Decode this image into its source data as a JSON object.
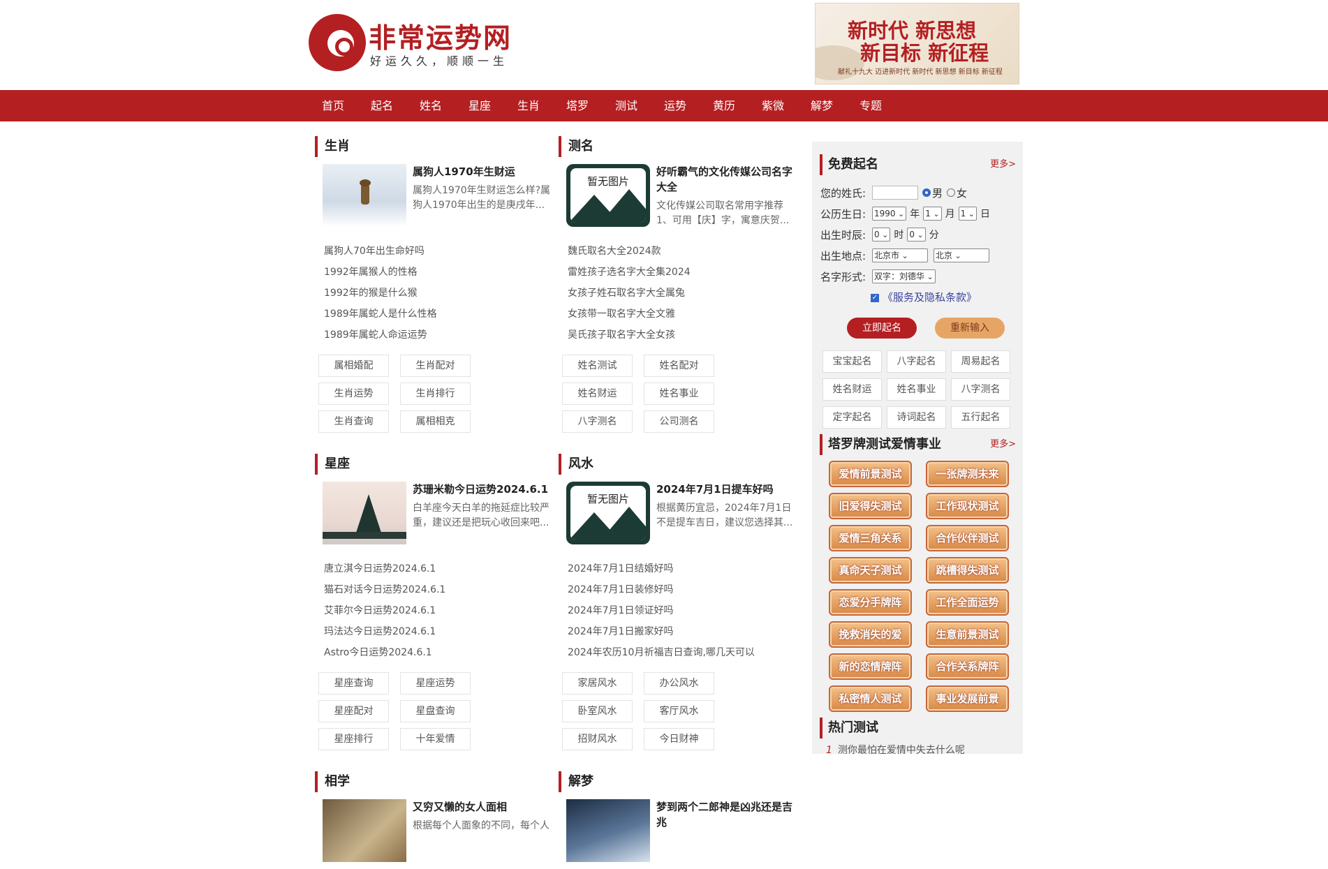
{
  "header": {
    "logo_title": "非常运势网",
    "logo_slogan": "好运久久，顺顺一生",
    "banner_line1": "新时代 新思想",
    "banner_line2": "新目标 新征程",
    "banner_sub": "献礼十九大 迈进新时代 新时代 新思想 新目标 新征程"
  },
  "nav": [
    "首页",
    "起名",
    "姓名",
    "星座",
    "生肖",
    "塔罗",
    "测试",
    "运势",
    "黄历",
    "紫微",
    "解梦",
    "专题"
  ],
  "sections": {
    "shengxiao": {
      "title": "生肖",
      "feature_title": "属狗人1970年生财运",
      "feature_desc": "属狗人1970年生财运怎么样?属狗人1970年出生的是庚戌年...",
      "links": [
        "属狗人70年出生命好吗",
        "1992年属猴人的性格",
        "1992年的猴是什么猴",
        "1989年属蛇人是什么性格",
        "1989年属蛇人命运运势"
      ],
      "tags": [
        "属相婚配",
        "生肖配对",
        "生肖运势",
        "生肖排行",
        "生肖查询",
        "属相相克"
      ]
    },
    "ceming": {
      "title": "测名",
      "noimg": "暂无图片",
      "feature_title": "好听霸气的文化传媒公司名字大全",
      "feature_desc": "文化传媒公司取名常用字推荐1、可用【庆】字，寓意庆贺...",
      "links": [
        "魏氏取名大全2024款",
        "雷姓孩子选名字大全集2024",
        "女孩子姓石取名字大全属兔",
        "女孩带一取名字大全文雅",
        "吴氏孩子取名字大全女孩"
      ],
      "tags": [
        "姓名测试",
        "姓名配对",
        "姓名财运",
        "姓名事业",
        "八字测名",
        "公司测名"
      ]
    },
    "xingzuo": {
      "title": "星座",
      "feature_title": "苏珊米勒今日运势2024.6.1",
      "feature_desc": "白羊座今天白羊的拖延症比较严重，建议还是把玩心收回来吧...",
      "links": [
        "唐立淇今日运势2024.6.1",
        "猫石对话今日运势2024.6.1",
        "艾菲尔今日运势2024.6.1",
        "玛法达今日运势2024.6.1",
        "Astro今日运势2024.6.1"
      ],
      "tags": [
        "星座查询",
        "星座运势",
        "星座配对",
        "星盘查询",
        "星座排行",
        "十年爱情"
      ]
    },
    "fengshui": {
      "title": "风水",
      "noimg": "暂无图片",
      "feature_title": "2024年7月1日提车好吗",
      "feature_desc": "根据黄历宜忌，2024年7月1日不是提车吉日，建议您选择其...",
      "links": [
        "2024年7月1日结婚好吗",
        "2024年7月1日装修好吗",
        "2024年7月1日领证好吗",
        "2024年7月1日搬家好吗",
        "2024年农历10月祈福吉日查询,哪几天可以"
      ],
      "tags": [
        "家居风水",
        "办公风水",
        "卧室风水",
        "客厅风水",
        "招财风水",
        "今日财神"
      ]
    },
    "xiangxue": {
      "title": "相学",
      "feature_title": "又穷又懒的女人面相",
      "feature_desc": "根据每个人面象的不同，每个人"
    },
    "jiemeng": {
      "title": "解梦",
      "feature_title": "梦到两个二郎神是凶兆还是吉兆",
      "feature_desc": ""
    }
  },
  "sidebar": {
    "free_naming_title": "免费起名",
    "more": "更多>",
    "surname_label": "您的姓氏:",
    "gender_male": "男",
    "gender_female": "女",
    "birth_date_label": "公历生日:",
    "year": "1990",
    "year_unit": "年",
    "month": "1",
    "month_unit": "月",
    "day": "1",
    "day_unit": "日",
    "birth_time_label": "出生时辰:",
    "hour": "0",
    "hour_unit": "时",
    "minute": "0",
    "minute_unit": "分",
    "birth_place_label": "出生地点:",
    "province": "北京市",
    "city": "北京",
    "name_form_label": "名字形式:",
    "name_form": "双字：刘德华",
    "terms": "《服务及隐私条款》",
    "btn_submit": "立即起名",
    "btn_reset": "重新输入",
    "naming_tags": [
      "宝宝起名",
      "八字起名",
      "周易起名",
      "姓名财运",
      "姓名事业",
      "八字测名",
      "定字起名",
      "诗词起名",
      "五行起名"
    ],
    "tarot_title": "塔罗牌测试爱情事业",
    "tarot_more": "更多>",
    "tarot_buttons": [
      "爱情前景测试",
      "一张牌测未来",
      "旧爱得失测试",
      "工作现状测试",
      "爱情三角关系",
      "合作伙伴测试",
      "真命天子测试",
      "跳槽得失测试",
      "恋爱分手牌阵",
      "工作全面运势",
      "挽救消失的爱",
      "生意前景测试",
      "新的恋情牌阵",
      "合作关系牌阵",
      "私密情人测试",
      "事业发展前景"
    ],
    "hot_title": "热门测试",
    "hot_items": [
      {
        "num": "1",
        "text": "测你最怕在爱情中失去什么呢"
      }
    ]
  }
}
